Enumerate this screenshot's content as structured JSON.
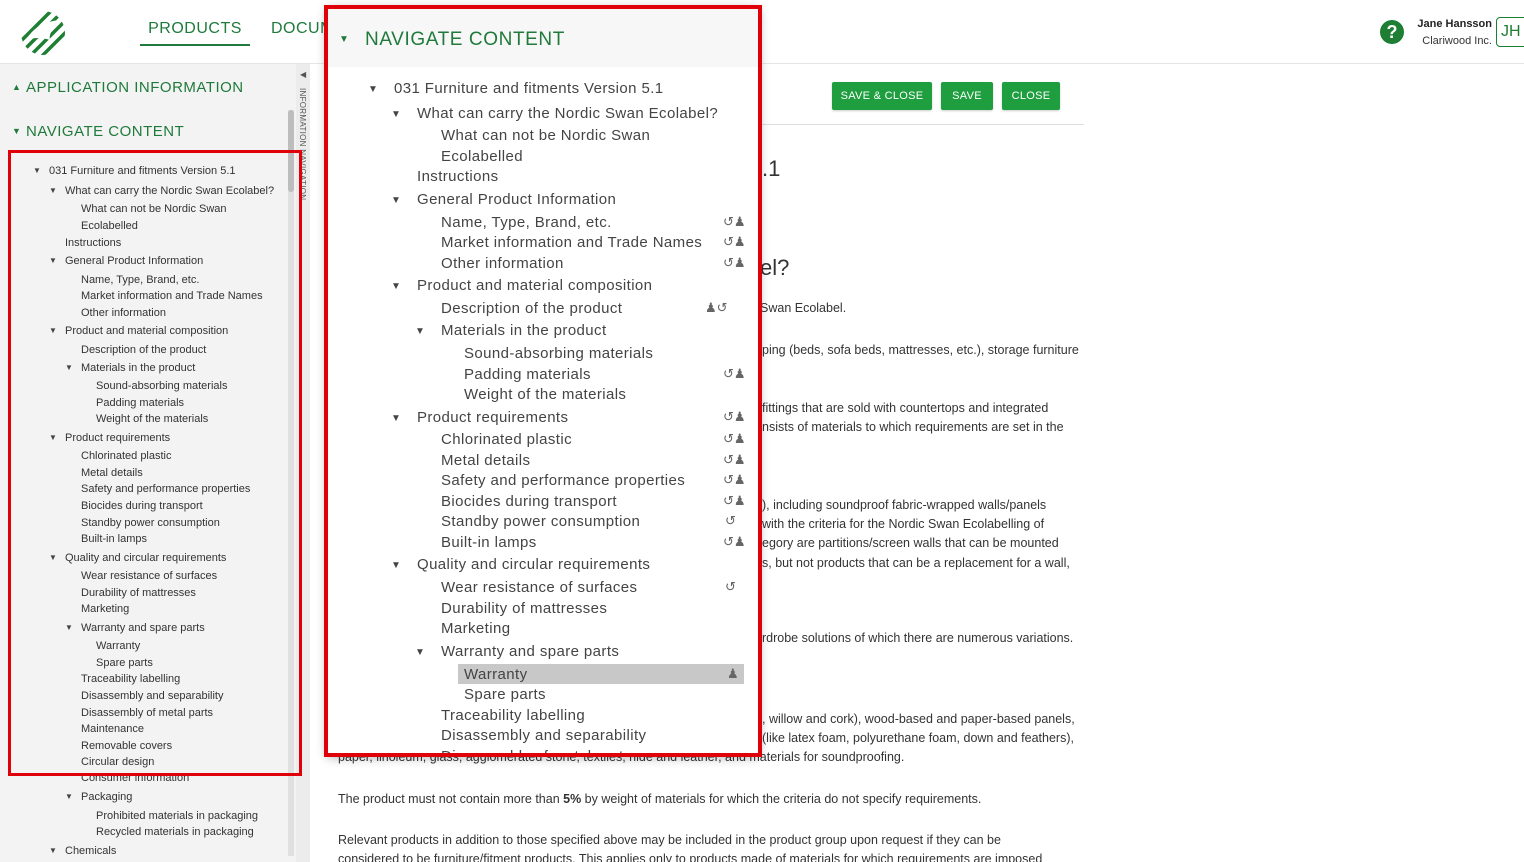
{
  "header": {
    "nav_products": "PRODUCTS",
    "nav_docum": "DOCUM",
    "help": "?",
    "user_name": "Jane Hansson",
    "user_company": "Clariwood Inc.",
    "avatar": "JH"
  },
  "sidebar": {
    "application_information": "APPLICATION INFORMATION",
    "navigate_content": "NAVIGATE CONTENT",
    "vertical_tab": "INFORMATION NAVIGATION"
  },
  "tree": [
    {
      "label": "031 Furniture and fitments Version 5.1",
      "caret": true
    },
    {
      "label": "What can carry the Nordic Swan Ecolabel?",
      "caret": true
    },
    {
      "label": "What can not be Nordic Swan"
    },
    {
      "label": "Ecolabelled"
    },
    {
      "label": "Instructions"
    },
    {
      "label": "General Product Information",
      "caret": true
    },
    {
      "label": "Name, Type, Brand, etc."
    },
    {
      "label": "Market information and Trade Names"
    },
    {
      "label": "Other information"
    },
    {
      "label": "Product and material composition",
      "caret": true
    },
    {
      "label": "Description of the product"
    },
    {
      "label": "Materials in the product",
      "caret": true
    },
    {
      "label": "Sound-absorbing materials"
    },
    {
      "label": "Padding materials"
    },
    {
      "label": "Weight of the materials"
    },
    {
      "label": "Product requirements",
      "caret": true
    },
    {
      "label": "Chlorinated plastic"
    },
    {
      "label": "Metal details"
    },
    {
      "label": "Safety and performance properties"
    },
    {
      "label": "Biocides during transport"
    },
    {
      "label": "Standby power consumption"
    },
    {
      "label": "Built-in lamps"
    },
    {
      "label": "Quality and circular requirements",
      "caret": true
    },
    {
      "label": "Wear resistance of surfaces"
    },
    {
      "label": "Durability of mattresses"
    },
    {
      "label": "Marketing"
    },
    {
      "label": "Warranty and spare parts",
      "caret": true
    },
    {
      "label": "Warranty"
    },
    {
      "label": "Spare parts"
    },
    {
      "label": "Traceability labelling"
    },
    {
      "label": "Disassembly and separability"
    },
    {
      "label": "Disassembly of metal parts"
    },
    {
      "label": "Maintenance"
    },
    {
      "label": "Removable covers"
    },
    {
      "label": "Circular design"
    },
    {
      "label": "Consumer information"
    },
    {
      "label": "Packaging",
      "caret": true
    },
    {
      "label": "Prohibited materials in packaging"
    },
    {
      "label": "Recycled materials in packaging"
    },
    {
      "label": "Chemicals",
      "caret": true
    }
  ],
  "popup": {
    "title": "NAVIGATE CONTENT",
    "icons": {
      "edit_person": "↺♟",
      "edit_cycle": "↺",
      "person_cycle": "♟↺",
      "person": "♟"
    }
  },
  "main": {
    "save_close": "SAVE & CLOSE",
    "save": "SAVE",
    "close": "CLOSE",
    "title_frag_1": ".1",
    "title_frag_2": "el?",
    "p1": "Swan Ecolabel.",
    "p2": "ping (beds, sofa beds, mattresses, etc.), storage furniture",
    "p3a": "fittings that are sold with countertops and integrated",
    "p3b": "nsists of materials to which requirements are set in the",
    "p4a": "), including soundproof fabric-wrapped walls/panels",
    "p4b": "with the criteria for the Nordic Swan Ecolabelling of",
    "p4c": "egory are partitions/screen walls that can be mounted",
    "p4d": "s, but not products that can be a replacement for a wall,",
    "p5": "rdrobe solutions of which there are numerous variations.",
    "p6a": ", willow and cork), wood-based and paper-based panels,",
    "p6b": "(like latex foam, polyurethane foam, down and feathers),",
    "p6c": "paper, linoleum, glass, agglomerated stone, textiles, hide and leather, and materials for soundproofing.",
    "p7_pre": "The product must not contain more than ",
    "p7_bold": "5%",
    "p7_post": " by weight of materials for which the criteria do not specify requirements.",
    "p8a": "Relevant products in addition to those specified above may be included in the product group upon request if they can be",
    "p8b": "considered to be furniture/fitment products. This applies only to products made of materials for which requirements are imposed"
  }
}
